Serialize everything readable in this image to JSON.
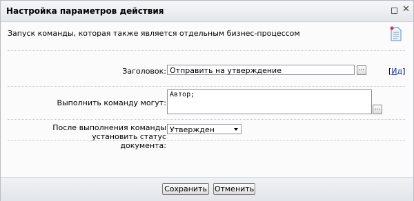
{
  "dialog": {
    "title": "Настройка параметров действия",
    "close_icon": "close-icon",
    "maximize_icon": "maximize-icon"
  },
  "description": "Запуск команды, которая также является отдельным бизнес-процессом",
  "fields": {
    "title_label": "Заголовок:",
    "title_value": "Отправить на утверждение",
    "title_dots": "...",
    "id_link_prefix": "[",
    "id_link": "Ид",
    "id_link_suffix": "]",
    "executors_label": "Выполнить команду могут:",
    "executors_value": "Автор;",
    "executors_dots": "...",
    "status_label_line1": "После выполнения команды установить статус",
    "status_label_line2": "документа:",
    "status_value": "Утвержден"
  },
  "buttons": {
    "save": "Сохранить",
    "cancel": "Отменить"
  }
}
